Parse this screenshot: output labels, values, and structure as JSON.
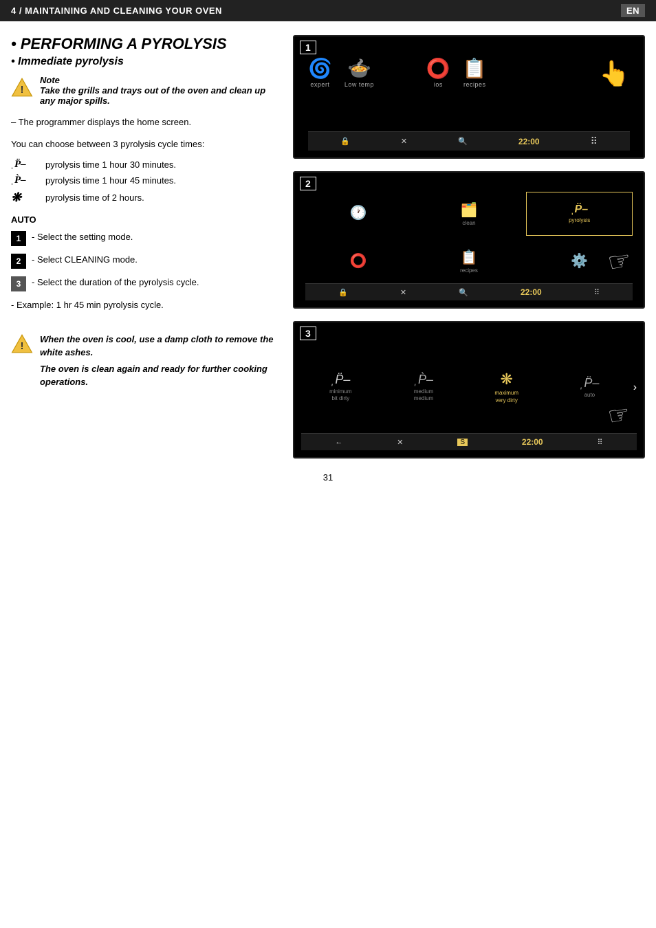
{
  "header": {
    "title": "4 / MAINTAINING AND CLEANING YOUR OVEN",
    "lang": "EN"
  },
  "section": {
    "title": "PERFORMING A PYROLYSIS",
    "subsection": "Immediate pyrolysis",
    "note_label": "Note",
    "note_body": "Take the grills and trays out of the oven and clean up any major spills.",
    "para1": "– The programmer displays the home screen.",
    "para2": "You can choose between 3 pyrolysis cycle times:",
    "pyro_times": [
      {
        "icon": "1h30",
        "text": "pyrolysis time 1 hour 30 minutes."
      },
      {
        "icon": "1h45",
        "text": "pyrolysis time 1 hour 45 minutes."
      },
      {
        "icon": "2h",
        "text": "pyrolysis time of 2 hours."
      }
    ],
    "auto_label": "AUTO",
    "steps": [
      {
        "num": "1",
        "text": "- Select the setting mode."
      },
      {
        "num": "2",
        "text": "- Select CLEANING mode."
      },
      {
        "num": "3",
        "text": "- Select the duration of the pyrolysis cycle."
      }
    ],
    "example": "- Example: 1 hr 45 min pyrolysis cycle.",
    "bottom_note1": "When the oven is cool, use a damp cloth to remove the white ashes.",
    "bottom_note2": "The oven is clean again and ready for further cooking operations."
  },
  "screens": {
    "screen1": {
      "number": "1",
      "icons": [
        {
          "symbol": "🌀",
          "label": "expert"
        },
        {
          "symbol": "🍲",
          "label": "Low temp"
        },
        {
          "symbol": "⭕",
          "label": "ios"
        },
        {
          "symbol": "📋",
          "label": "recipes"
        },
        {
          "symbol": "👆",
          "label": ""
        }
      ],
      "statusbar": {
        "items": [
          "🔒",
          "✗",
          "🔍",
          "22:00",
          "⠿"
        ]
      }
    },
    "screen2": {
      "number": "2",
      "statusbar": {
        "time": "22:00"
      }
    },
    "screen3": {
      "number": "3",
      "options": [
        {
          "label": "minimum\nbit dirty",
          "selected": false
        },
        {
          "label": "medium\nmedium",
          "selected": false
        },
        {
          "label": "maximum\nvery dirty",
          "selected": true
        },
        {
          "label": "auto",
          "selected": false
        }
      ],
      "statusbar": {
        "time": "22:00"
      }
    }
  },
  "page_number": "31"
}
